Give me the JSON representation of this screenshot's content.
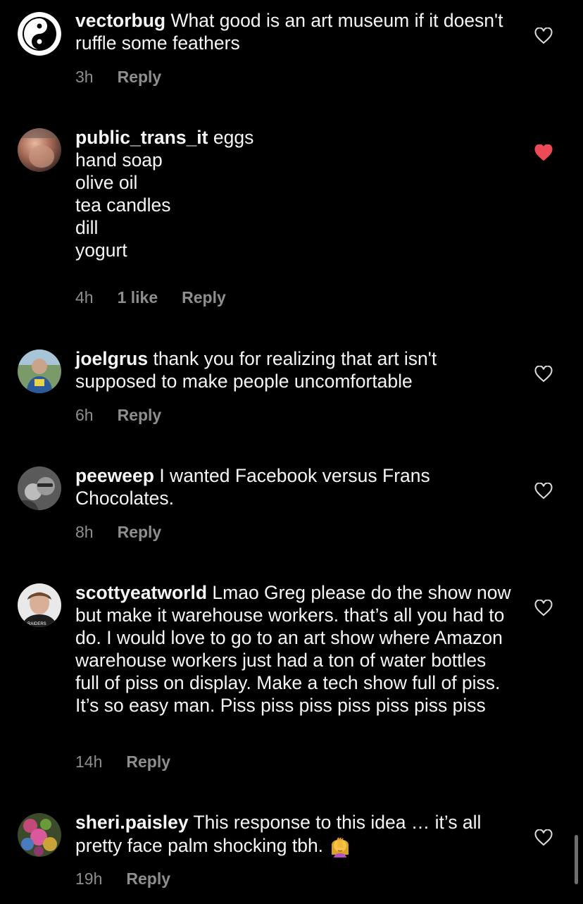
{
  "comments": [
    {
      "username": "vectorbug",
      "text": "What good is an art museum if it doesn't ruffle some feathers",
      "time": "3h",
      "likes": "",
      "reply": "Reply",
      "liked": false,
      "avatar_icon": "yin-yang-duck-icon"
    },
    {
      "username": "public_trans_it",
      "text": "eggs\nhand soap\nolive oil\ntea candles\ndill\nyogurt",
      "time": "4h",
      "likes": "1 like",
      "reply": "Reply",
      "liked": true,
      "avatar_icon": "user-photo"
    },
    {
      "username": "joelgrus",
      "text": "thank you for realizing that art isn't supposed to make people uncomfortable",
      "time": "6h",
      "likes": "",
      "reply": "Reply",
      "liked": false,
      "avatar_icon": "user-photo"
    },
    {
      "username": "peeweep",
      "text": "I wanted Facebook versus Frans Chocolates.",
      "time": "8h",
      "likes": "",
      "reply": "Reply",
      "liked": false,
      "avatar_icon": "user-photo"
    },
    {
      "username": "scottyeatworld",
      "text": "Lmao Greg please do the show now but make it warehouse workers. that’s all you had to do. I would love to go to an art show where Amazon warehouse workers just had a ton of water bottles full of piss on display. Make a tech show full of piss. It’s so easy man. Piss piss piss piss piss piss piss",
      "time": "14h",
      "likes": "",
      "reply": "Reply",
      "liked": false,
      "avatar_icon": "user-photo"
    },
    {
      "username": "sheri.paisley",
      "text": "This response to this idea … it’s all pretty face palm shocking tbh.",
      "time": "19h",
      "likes": "",
      "reply": "Reply",
      "liked": false,
      "avatar_icon": "user-photo",
      "emoji": "face-palm-emoji"
    }
  ],
  "colors": {
    "background": "#000000",
    "text": "#f5f5f5",
    "meta": "#8e8e8e",
    "heart_liked": "#ed4956",
    "heart_outline": "#dbdbdb"
  }
}
